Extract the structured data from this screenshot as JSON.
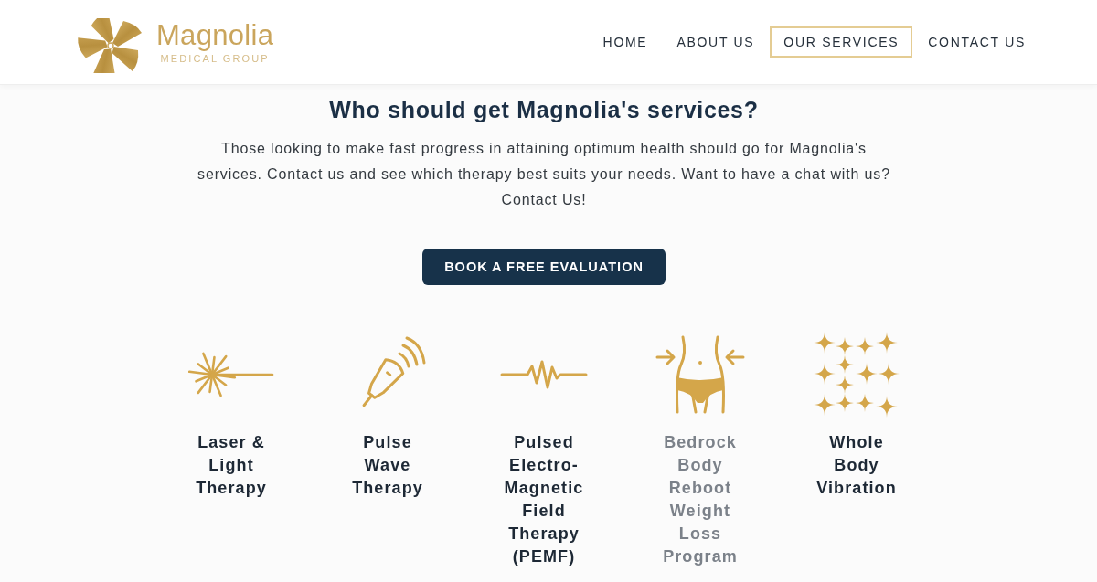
{
  "header": {
    "logo": {
      "name": "Magnolia",
      "tagline": "MEDICAL GROUP"
    },
    "nav": [
      {
        "label": "HOME",
        "selected": false
      },
      {
        "label": "ABOUT US",
        "selected": false
      },
      {
        "label": "OUR SERVICES",
        "selected": true
      },
      {
        "label": "CONTACT US",
        "selected": false
      }
    ]
  },
  "intro": {
    "heading": "Who should get Magnolia's services?",
    "text": "Those looking to make fast progress in attaining optimum health should go for Magnolia's services. Contact us and see which therapy best suits your needs. Want to have a chat with us? Contact Us!",
    "button": "BOOK A FREE EVALUATION"
  },
  "services": [
    {
      "kind": "laser",
      "label": "Laser & Light Therapy",
      "muted": false
    },
    {
      "kind": "probe",
      "label": "Pulse Wave Therapy",
      "muted": false
    },
    {
      "kind": "pulse",
      "label": "Pulsed Electro-Magnetic Field Therapy (PEMF)",
      "muted": false
    },
    {
      "kind": "waist",
      "label": "Bedrock Body Reboot Weight Loss Program",
      "muted": true
    },
    {
      "kind": "sparkles",
      "label": "Whole Body Vibration",
      "muted": false
    }
  ]
}
